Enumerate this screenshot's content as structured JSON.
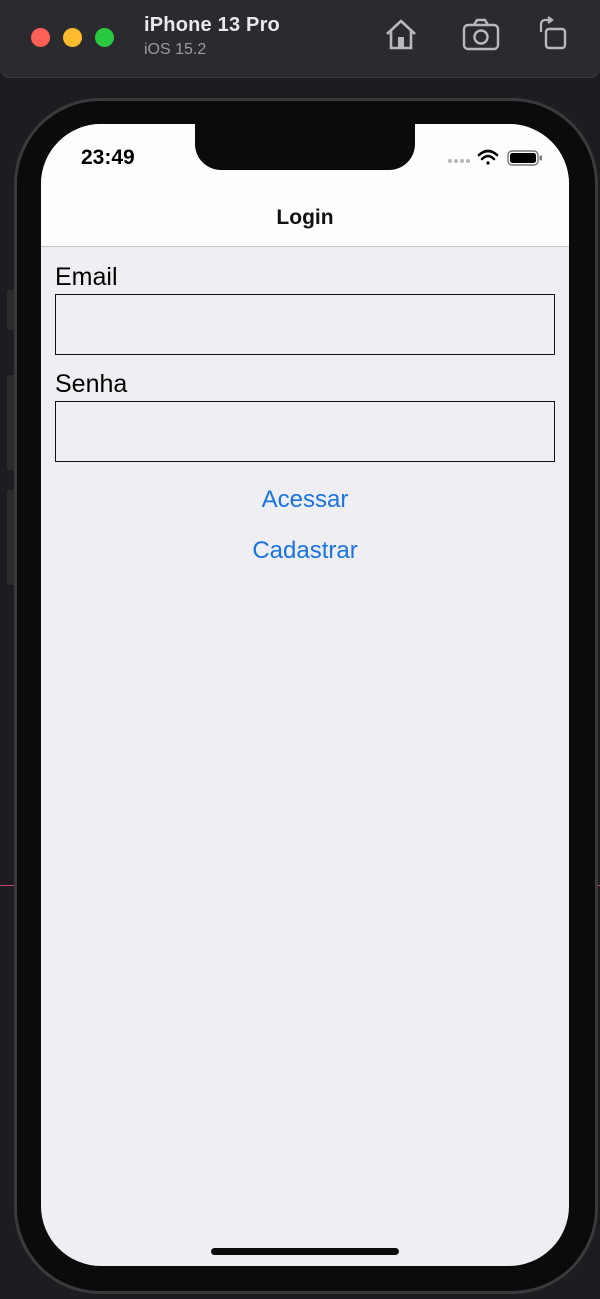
{
  "simulator": {
    "device_name": "iPhone 13 Pro",
    "os_version": "iOS 15.2",
    "toolbar_icons": [
      "home-icon",
      "screenshot-icon",
      "rotate-icon"
    ]
  },
  "status_bar": {
    "time": "23:49",
    "icons": [
      "cellular-signal-icon",
      "wifi-icon",
      "battery-icon"
    ]
  },
  "nav_bar": {
    "title": "Login"
  },
  "form": {
    "email_label": "Email",
    "email_value": "",
    "password_label": "Senha",
    "password_value": "",
    "login_button": "Acessar",
    "register_button": "Cadastrar"
  },
  "colors": {
    "accent": "#1a73e2",
    "screen_background": "#efeef3",
    "nav_background": "#fefefe"
  }
}
